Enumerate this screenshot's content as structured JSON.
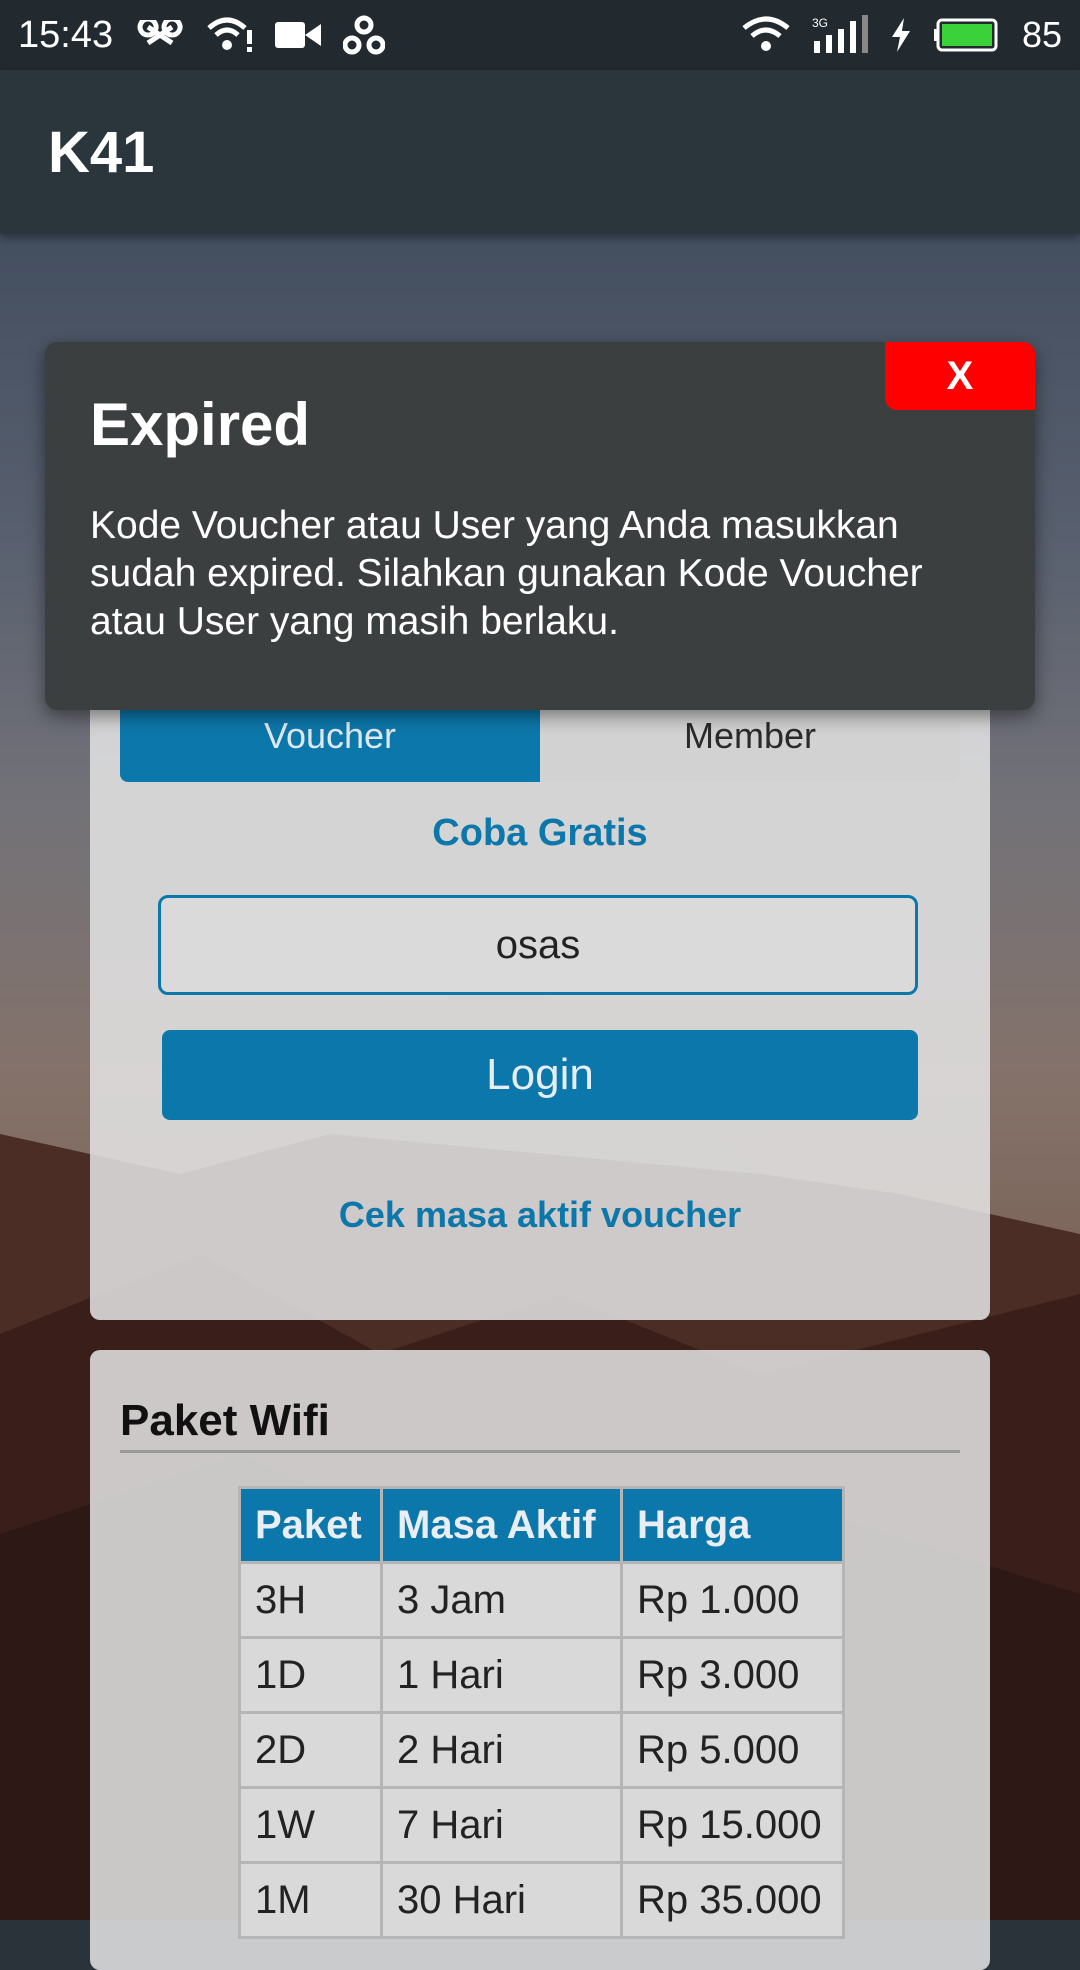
{
  "status_bar": {
    "time": "15:43",
    "battery_percent": "85",
    "icons": [
      "link-icon",
      "wifi-alert-icon",
      "video-icon",
      "hotspot-icon",
      "wifi-icon",
      "signal-3g-icon",
      "charging-icon",
      "battery-icon"
    ]
  },
  "app_bar": {
    "title": "K41"
  },
  "modal": {
    "close_label": "X",
    "title": "Expired",
    "body": "Kode Voucher atau User yang Anda masukkan sudah expired. Silahkan gunakan Kode Voucher atau User yang masih berlaku."
  },
  "login": {
    "tabs": [
      {
        "label": "Voucher",
        "active": true
      },
      {
        "label": "Member",
        "active": false
      }
    ],
    "coba_gratis": "Coba Gratis",
    "voucher_value": "osas",
    "login_label": "Login",
    "cek_link": "Cek masa aktif voucher"
  },
  "paket": {
    "title": "Paket Wifi",
    "headers": [
      "Paket",
      "Masa Aktif",
      "Harga"
    ],
    "rows": [
      [
        "3H",
        "3 Jam",
        "Rp 1.000"
      ],
      [
        "1D",
        "1 Hari",
        "Rp 3.000"
      ],
      [
        "2D",
        "2 Hari",
        "Rp 5.000"
      ],
      [
        "1W",
        "7 Hari",
        "Rp 15.000"
      ],
      [
        "1M",
        "30 Hari",
        "Rp 35.000"
      ]
    ]
  },
  "colors": {
    "accent": "#0c77aa",
    "close_button": "#fe0000",
    "modal_bg": "#3b3f3f",
    "app_bar": "#2b353c"
  }
}
